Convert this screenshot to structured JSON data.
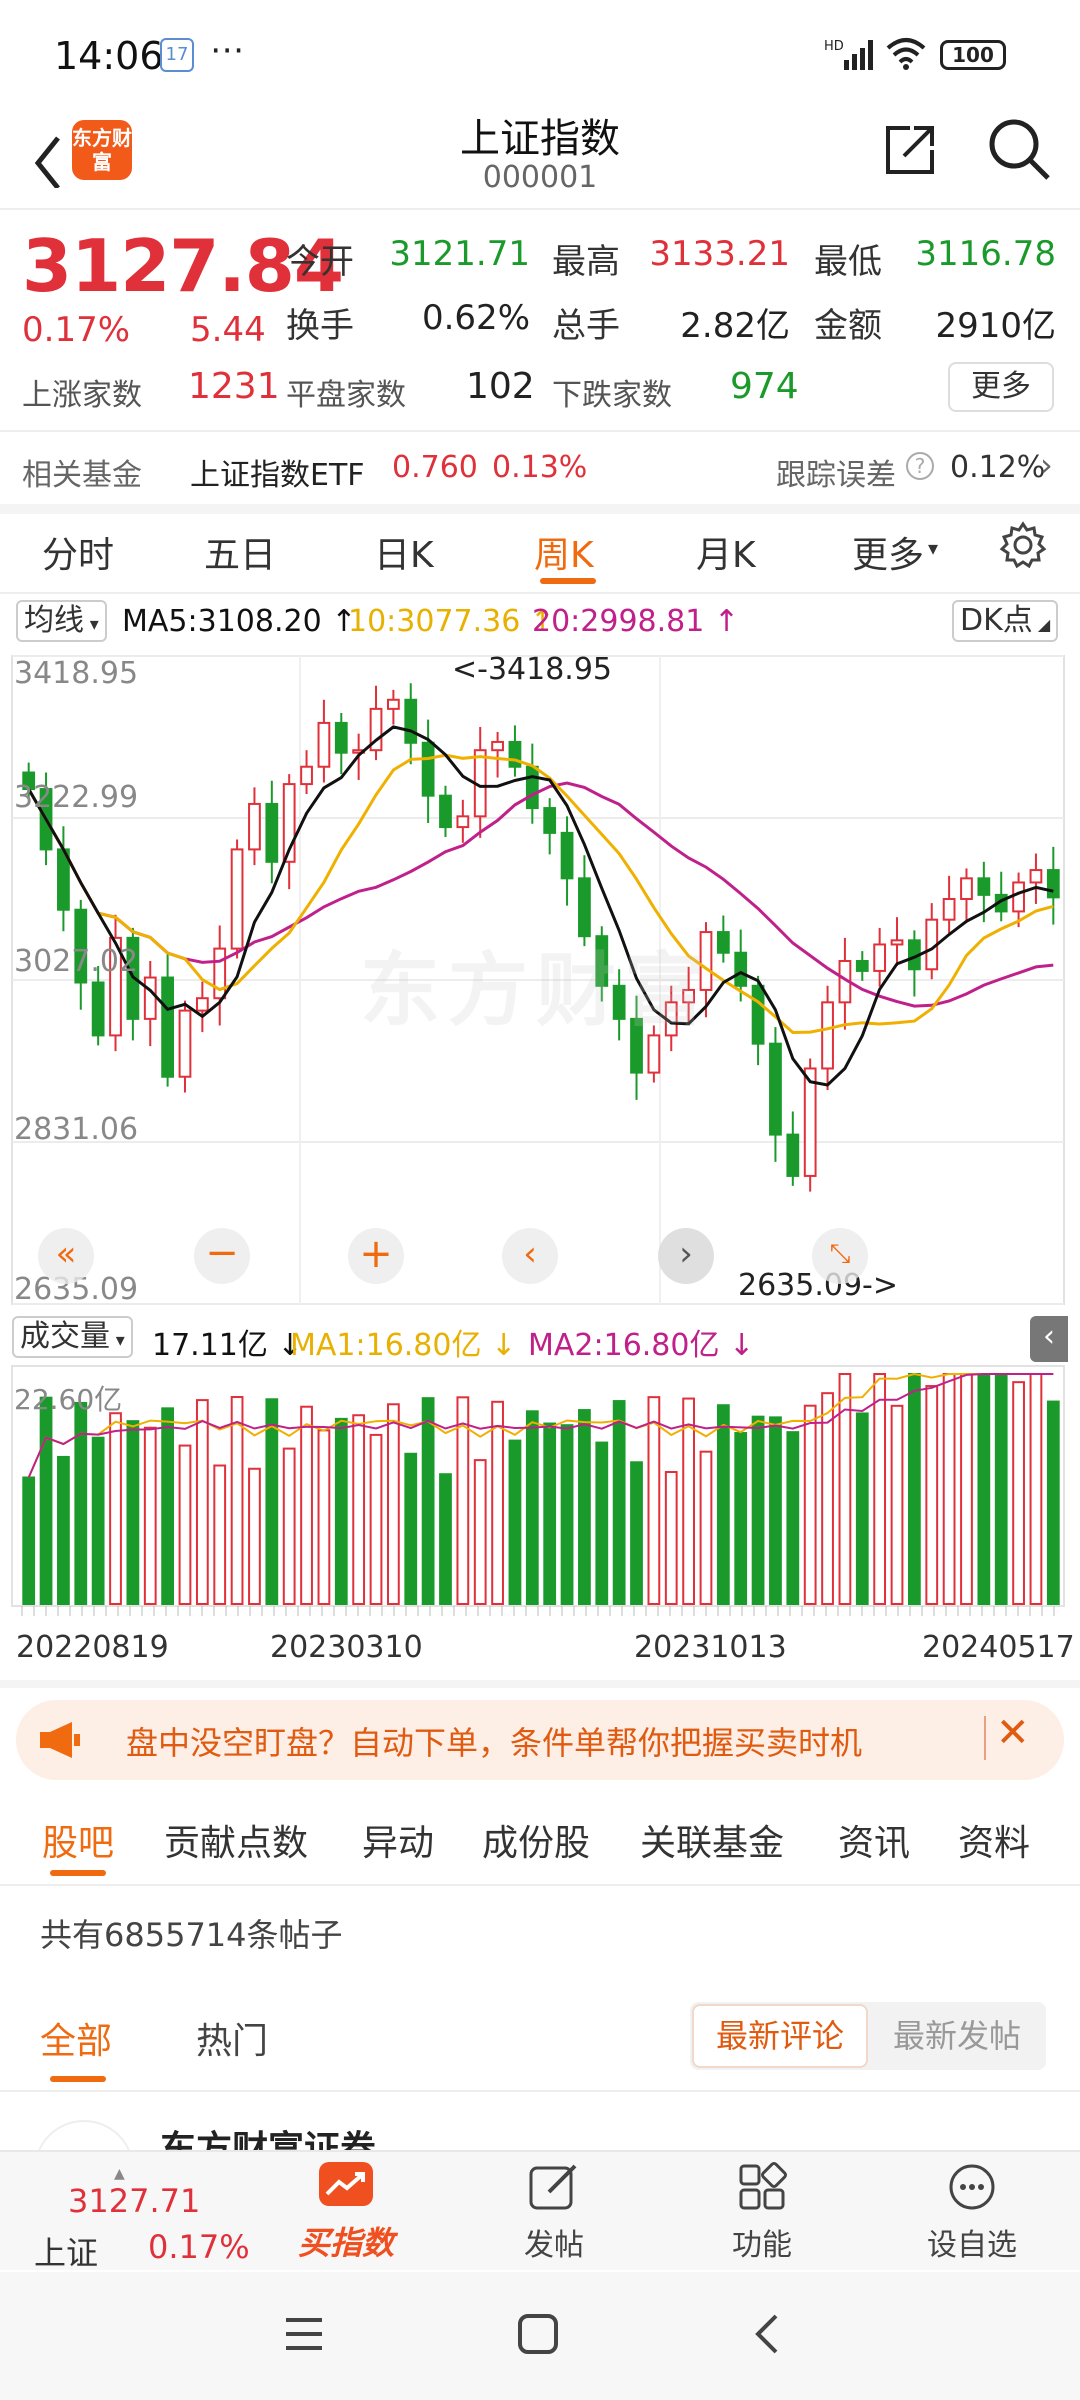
{
  "status_bar": {
    "time": "14:06",
    "battery": "100",
    "notification_badge": "17",
    "icons": [
      "calendar-icon",
      "more-dots-icon",
      "hd-signal-icon",
      "wifi-icon",
      "battery-icon"
    ]
  },
  "header": {
    "title": "上证指数",
    "code": "000001",
    "logo_text": "东方财富",
    "back_icon": "back-arrow-icon",
    "share_icon": "share-icon",
    "search_icon": "search-icon"
  },
  "quote": {
    "price": "3127.84",
    "change_pct": "0.17%",
    "change_abs": "5.44",
    "open_label": "今开",
    "open": "3121.71",
    "high_label": "最高",
    "high": "3133.21",
    "low_label": "最低",
    "low": "3116.78",
    "turnover_label": "换手",
    "turnover": "0.62%",
    "volume_label": "总手",
    "volume": "2.82亿",
    "amount_label": "金额",
    "amount": "2910亿",
    "up_label": "上涨家数",
    "up": "1231",
    "flat_label": "平盘家数",
    "flat": "102",
    "down_label": "下跌家数",
    "down": "974",
    "more_label": "更多"
  },
  "fund": {
    "label": "相关基金",
    "name": "上证指数ETF",
    "price": "0.760",
    "pct": "0.13%",
    "tracking_label": "跟踪误差",
    "tracking_value": "0.12%"
  },
  "tabs": [
    "分时",
    "五日",
    "日K",
    "周K",
    "月K",
    "更多"
  ],
  "active_tab": 3,
  "ma_row": {
    "selector": "均线",
    "ma5": "MA5:3108.20",
    "ma10": "10:3077.36",
    "ma20": "20:2998.81",
    "dk": "DK点"
  },
  "kline_axis": {
    "y1": "3418.95",
    "y2": "3222.99",
    "y3": "3027.02",
    "y4": "2831.06",
    "y5": "2635.09",
    "high_marker": "<-3418.95",
    "low_marker": "2635.09->",
    "watermark": "东方财富"
  },
  "volume_row": {
    "selector": "成交量",
    "value": "17.11亿",
    "ma1": "MA1:16.80亿",
    "ma2": "MA2:16.80亿",
    "max": "22.60亿"
  },
  "dates": [
    "20220819",
    "20230310",
    "20231013",
    "20240517"
  ],
  "banner": {
    "text": "盘中没空盯盘？自动下单，条件单帮你把握买卖时机"
  },
  "tabs2": [
    "股吧",
    "贡献点数",
    "异动",
    "成份股",
    "关联基金",
    "资讯",
    "资料"
  ],
  "post_count": "共有6855714条帖子",
  "filter": {
    "all": "全部",
    "hot": "热门",
    "newest_comment": "最新评论",
    "newest_post": "最新发帖"
  },
  "partial_author": "东方财富证券",
  "bottom_nav": {
    "index_price": "3127.71",
    "index_name": "上证",
    "index_pct": "0.17%",
    "buy": "买指数",
    "post": "发帖",
    "func": "功能",
    "watch": "设自选"
  },
  "colors": {
    "up": "#e0303a",
    "down": "#1a9a2a",
    "accent": "#f06a10",
    "ma5": "#111111",
    "ma10": "#f0b000",
    "ma20": "#c0208a"
  },
  "chart_data": {
    "type": "candlestick",
    "period": "weekly",
    "ylim": [
      2635.09,
      3418.95
    ],
    "y_ticks": [
      3418.95,
      3222.99,
      3027.02,
      2831.06,
      2635.09
    ],
    "x_ticks": [
      "20220819",
      "20230310",
      "20231013",
      "20240517"
    ],
    "close_approx": [
      3258,
      3185,
      3112,
      3024,
      2960,
      3078,
      2980,
      3030,
      2910,
      2990,
      3005,
      3065,
      3185,
      3240,
      3170,
      3264,
      3285,
      3338,
      3302,
      3305,
      3355,
      3366,
      3314,
      3250,
      3212,
      3225,
      3305,
      3315,
      3285,
      3235,
      3205,
      3150,
      3080,
      3020,
      2980,
      2915,
      2960,
      3000,
      3015,
      3085,
      3060,
      3020,
      2950,
      2840,
      2790,
      2920,
      3000,
      3050,
      3038,
      3070,
      3075,
      3040,
      3100,
      3125,
      3150,
      3130,
      3110,
      3145,
      3160,
      3127
    ],
    "ma_values": {
      "MA5": 3108.2,
      "MA10": 3077.36,
      "MA20": 2998.81
    },
    "volume": {
      "max_label": "22.60亿",
      "last": "17.11亿",
      "MA1": "16.80亿",
      "MA2": "16.80亿"
    }
  }
}
